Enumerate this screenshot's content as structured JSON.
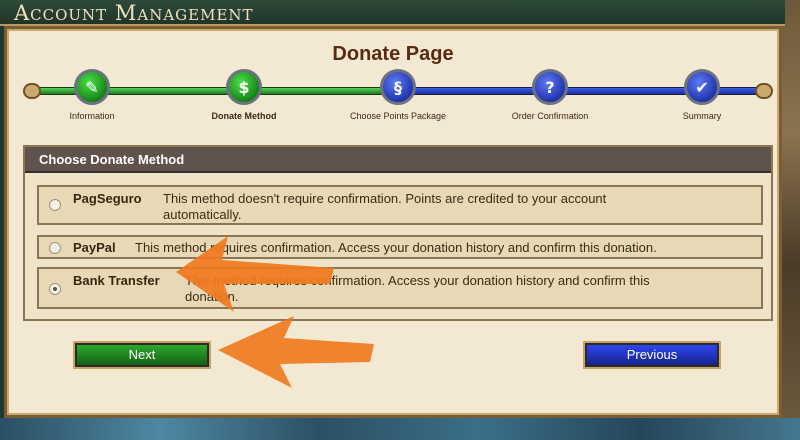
{
  "header": {
    "title": "Account Management"
  },
  "page": {
    "title": "Donate Page"
  },
  "steps": [
    {
      "label": "Information",
      "state": "done",
      "icon": "quill-icon"
    },
    {
      "label": "Donate Method",
      "state": "done",
      "icon": "coins-icon"
    },
    {
      "label": "Choose Points Package",
      "state": "todo",
      "icon": "scroll-icon"
    },
    {
      "label": "Order Confirmation",
      "state": "todo",
      "icon": "question-icon"
    },
    {
      "label": "Summary",
      "state": "todo",
      "icon": "checkmark-icon"
    }
  ],
  "section": {
    "title": "Choose Donate Method"
  },
  "methods": [
    {
      "name": "PagSeguro",
      "desc_line1": "This method doesn't require confirmation. Points are credited to your account",
      "desc_line2": "automatically.",
      "selected": false
    },
    {
      "name": "PayPal",
      "desc_line1": "This method requires confirmation. Access your donation history and confirm this donation.",
      "selected": false
    },
    {
      "name": "Bank Transfer",
      "desc_line1": "This method requires confirmation. Access your donation history and confirm this",
      "desc_line2": "donation.",
      "selected": true
    }
  ],
  "buttons": {
    "next": "Next",
    "previous": "Previous"
  },
  "colors": {
    "accent_green": "#1b8b1b",
    "accent_blue": "#1e2fc4",
    "annotation_orange": "#f07a1e"
  }
}
